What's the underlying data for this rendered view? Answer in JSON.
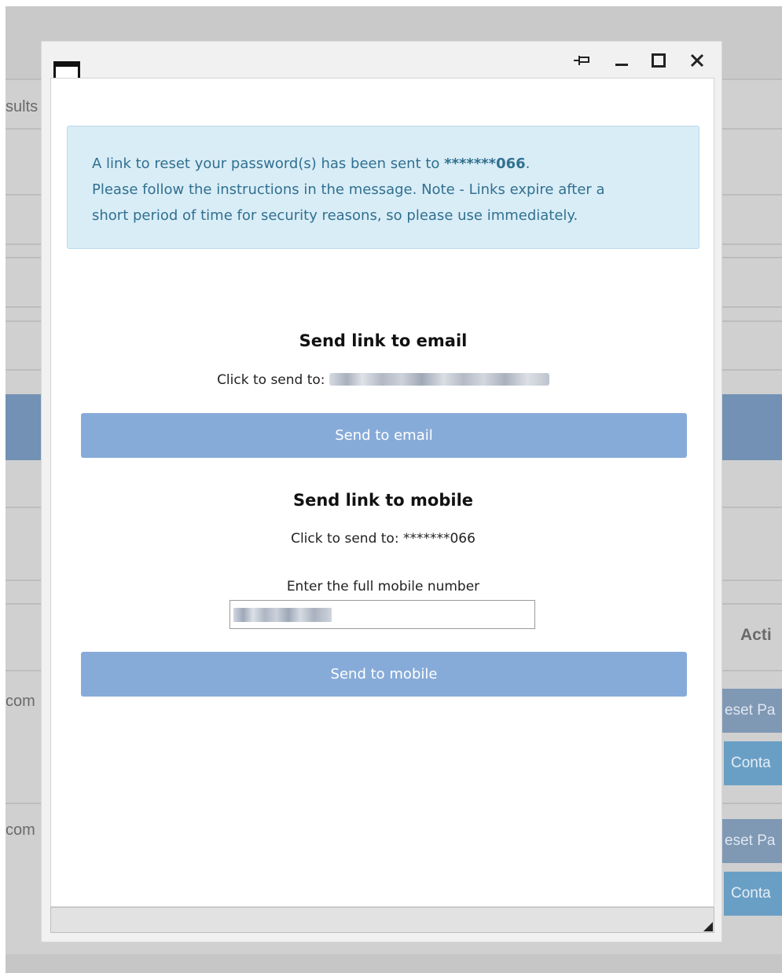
{
  "background": {
    "partial_texts": {
      "results": "sults",
      "actions_header": "Acti",
      "row1_email": "com",
      "row2_email": "com",
      "reset_button": "eset Pa",
      "contact_button": "Conta"
    }
  },
  "dialog": {
    "window_controls": {
      "pin": "pin-icon",
      "minimize": "minimize-icon",
      "maximize": "maximize-icon",
      "close": "close-icon"
    },
    "alert": {
      "line1_prefix": "A link to reset your password(s) has been sent to ",
      "line1_masked_number": "*******066",
      "line1_suffix": ".",
      "line2": "Please follow the instructions in the message. Note - Links expire after a",
      "line3": "short period of time for security reasons, so please use immediately."
    },
    "email_section": {
      "title": "Send link to email",
      "click_text": "Click to send to: ",
      "button_label": "Send to email"
    },
    "mobile_section": {
      "title": "Send link to mobile",
      "click_text": "Click to send to: *******066",
      "field_label": "Enter the full mobile number",
      "button_label": "Send to mobile"
    },
    "colors": {
      "alert_bg": "#d9edf7",
      "alert_text": "#31708f",
      "button_bg": "#87abd8"
    }
  }
}
